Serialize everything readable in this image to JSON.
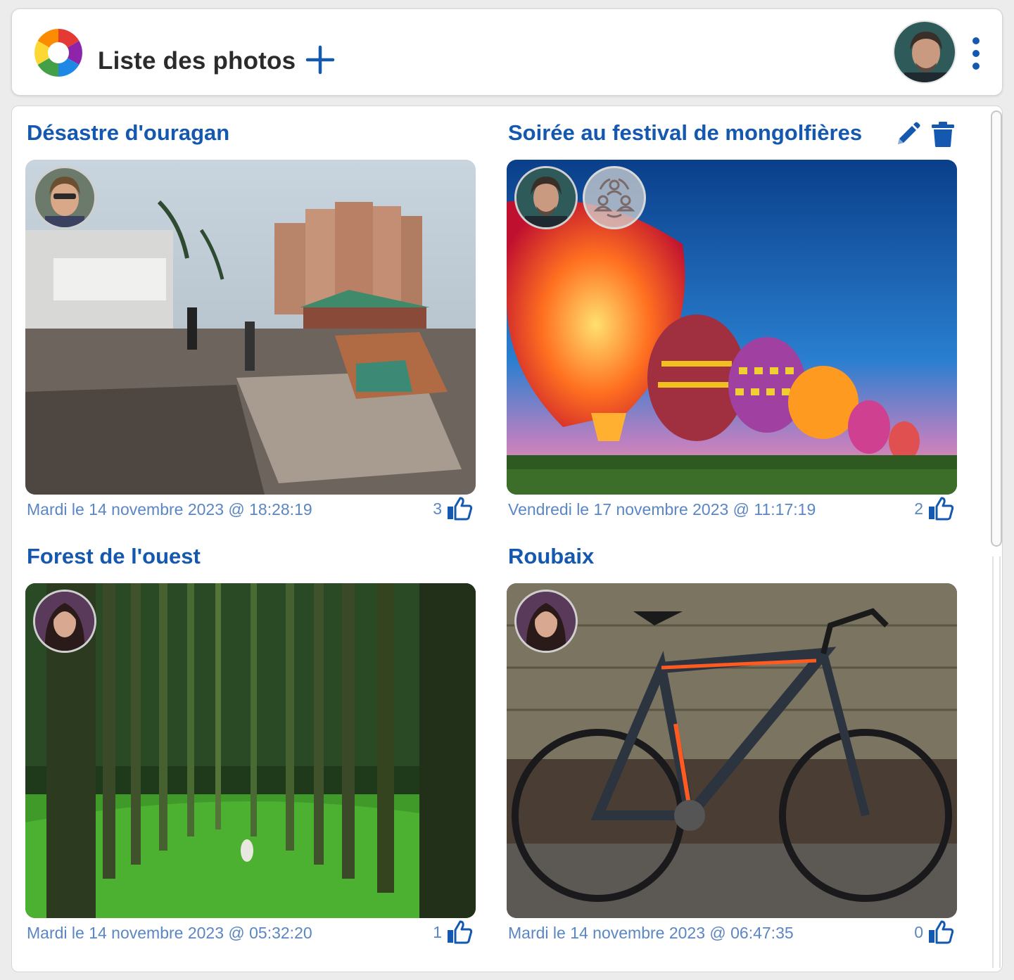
{
  "header": {
    "title": "Liste des photos",
    "add_icon": "plus-icon",
    "menu_icon": "vertical-dots-icon",
    "accent": "#1558b0"
  },
  "photos": [
    {
      "title": "Désastre d'ouragan",
      "date": "Mardi le 14 novembre 2023 @ 18:28:19",
      "likes": "3",
      "shared": false,
      "editable": false
    },
    {
      "title": "Soirée au festival de mongolfières",
      "date": "Vendredi le 17 novembre 2023 @ 11:17:19",
      "likes": "2",
      "shared": true,
      "editable": true
    },
    {
      "title": "Forest de l'ouest",
      "date": "Mardi le 14 novembre 2023 @ 05:32:20",
      "likes": "1",
      "shared": false,
      "editable": false
    },
    {
      "title": "Roubaix",
      "date": "Mardi le 14 novembre 2023 @ 06:47:35",
      "likes": "0",
      "shared": false,
      "editable": false
    }
  ],
  "colors": {
    "title_blue": "#1558b0",
    "date_blue": "#5b86c4"
  }
}
